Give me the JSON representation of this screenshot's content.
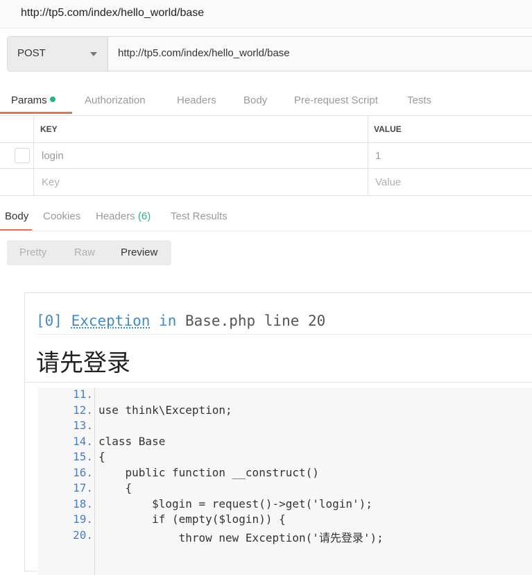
{
  "title": "http://tp5.com/index/hello_world/base",
  "request": {
    "method": "POST",
    "url": "http://tp5.com/index/hello_world/base"
  },
  "tabs": [
    "Params",
    "Authorization",
    "Headers",
    "Body",
    "Pre-request Script",
    "Tests"
  ],
  "params": {
    "header_key": "KEY",
    "header_value": "VALUE",
    "row": {
      "key": "login",
      "value": "1"
    },
    "placeholder_key": "Key",
    "placeholder_value": "Value"
  },
  "response_tabs": {
    "body": "Body",
    "cookies": "Cookies",
    "headers": "Headers",
    "headers_count": "(6)",
    "test_results": "Test Results"
  },
  "view_modes": [
    "Pretty",
    "Raw",
    "Preview"
  ],
  "exception": {
    "index": "[0]",
    "class": "Exception",
    "in": "in",
    "location": "Base.php line 20",
    "message": "请先登录"
  },
  "code": {
    "line_numbers": [
      "11.",
      "12.",
      "13.",
      "14.",
      "15.",
      "16.",
      "17.",
      "18.",
      "19.",
      "20."
    ],
    "lines": [
      "",
      "use think\\Exception;",
      "",
      "class Base",
      "{",
      "    public function __construct()",
      "    {",
      "        $login = request()->get('login');",
      "        if (empty($login)) {",
      "            throw new Exception('请先登录');"
    ]
  },
  "colors": {
    "accent": "#e8764a",
    "status_dot": "#26b47f",
    "code_keyword": "#4288ce"
  }
}
